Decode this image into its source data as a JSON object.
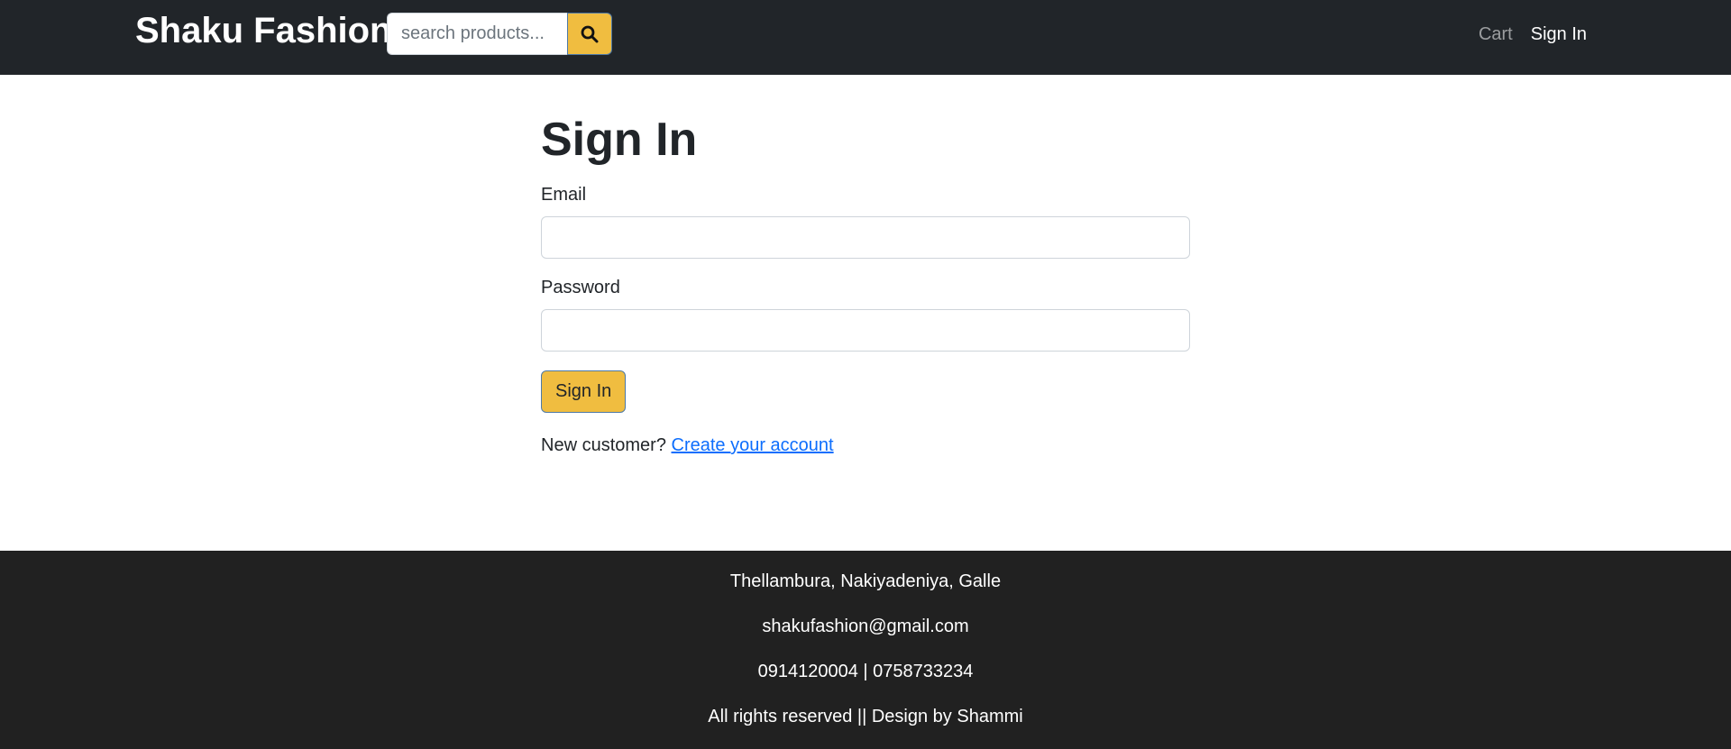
{
  "header": {
    "brand": "Shaku Fashion",
    "search": {
      "placeholder": "search products...",
      "value": ""
    },
    "nav": {
      "cart": "Cart",
      "sign_in": "Sign In"
    },
    "icons": {
      "search_button": "search-icon"
    }
  },
  "main": {
    "title": "Sign In",
    "email_label": "Email",
    "email_value": "",
    "password_label": "Password",
    "password_value": "",
    "submit_label": "Sign In",
    "new_customer_text": "New customer? ",
    "create_account_link": "Create your account"
  },
  "footer": {
    "address": "Thellambura, Nakiyadeniya, Galle",
    "email": "shakufashion@gmail.com",
    "phones": "0914120004 | 0758733234",
    "copyright": "All rights reserved || Design by Shammi"
  },
  "colors": {
    "navbar_bg": "#212529",
    "accent_yellow": "#f0bd40",
    "link_blue": "#0d6efd",
    "footer_bg": "#212121"
  }
}
